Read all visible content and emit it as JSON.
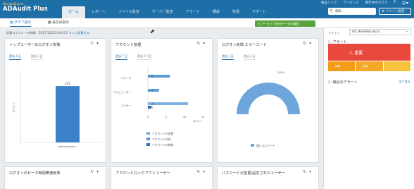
{
  "brand": "ManageEngine",
  "product": "ADAudit Plus",
  "nav": [
    "ホーム",
    "レポート",
    "ファイル監査",
    "サーバー監査",
    "アラート",
    "構成",
    "管理",
    "サポート"
  ],
  "top_links": [
    "製品リンク",
    "ライセンス",
    "数行中のタスク",
    "?"
  ],
  "search_placeholder": "検索...",
  "domain_button": "ドメイン設定",
  "subtabs": [
    "グラフ表示",
    "表形式表示"
  ],
  "archive_button": "アーカイブ済みデータの権限",
  "schedule": {
    "label": "収集スケジュール時間：2017/12/23 9:00:51",
    "link": "すぐに収集する"
  },
  "panels": {
    "p1": {
      "title": "トップユーザーのログオン失敗",
      "tabs": [
        "過去１日",
        "過去２日"
      ]
    },
    "p2": {
      "title": "アカウント管理",
      "tabs": [
        "過去７日",
        "過去３０日"
      ]
    },
    "p3": {
      "title": "ログオン失敗 エラーコード",
      "tabs": [
        "過去１日",
        "過去２日"
      ]
    },
    "p4": {
      "title": "ログオンのピーク時間帯使用率"
    },
    "p5": {
      "title": "アカウントロックアウトユーザー"
    },
    "p6": {
      "title": "パスワードが変更/設定されたユーザー"
    }
  },
  "right": {
    "domain_label": "ドメイン",
    "domain_value": "mc.develop.local",
    "alerts_title": "アラート",
    "critical": "重要",
    "trouble": "障害",
    "attention": "注意",
    "recent_title": "最近のアラート",
    "recent_link": "全て見る"
  },
  "colors": {
    "header": "#1e6ea8",
    "bar": "#3c82c8",
    "critical": "#e9483d",
    "trouble": "#f39c1a",
    "attention": "#f7c23e"
  },
  "chart_data": [
    {
      "type": "bar",
      "title": "トップユーザーのログオン失敗",
      "categories": [
        "Administrator"
      ],
      "values": [
        235
      ],
      "ylabel": "カウント",
      "ylim": [
        0,
        300
      ]
    },
    {
      "type": "bar",
      "title": "アカウント管理",
      "orientation": "horizontal",
      "categories": [
        "グループ",
        "コンピューター",
        "ユーザー"
      ],
      "series": [
        {
          "name": "アカウントの変更",
          "values": [
            0,
            0,
            11
          ]
        },
        {
          "name": "アカウント作成",
          "values": [
            6,
            3,
            0
          ]
        },
        {
          "name": "アカウントの削除",
          "values": [
            0,
            0,
            1
          ]
        }
      ],
      "data_labels": [
        "6",
        "3",
        "1",
        "11"
      ],
      "xticks": [
        0,
        5,
        10,
        15
      ],
      "xlabel": "カウント",
      "xlim": [
        0,
        15
      ]
    },
    {
      "type": "pie",
      "title": "ログオン失敗 エラーコード",
      "categories": [
        "悪いパスワード"
      ],
      "values": [
        100
      ],
      "data_label": "100%",
      "style": "donut"
    }
  ]
}
